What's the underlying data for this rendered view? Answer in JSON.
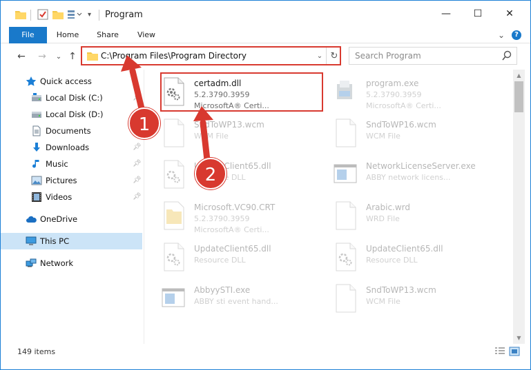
{
  "window": {
    "title": "Program",
    "minimize_glyph": "—",
    "maximize_glyph": "☐",
    "close_glyph": "✕"
  },
  "ribbon": {
    "tabs": [
      "File",
      "Home",
      "Share",
      "View"
    ],
    "collapse_glyph": "⌄",
    "help_glyph": "?"
  },
  "nav": {
    "back_glyph": "←",
    "forward_glyph": "→",
    "recent_glyph": "⌄",
    "up_glyph": "↑",
    "address": "C:\\Program Files\\Program Directory",
    "dropdown_glyph": "⌄",
    "refresh_glyph": "↻",
    "search_placeholder": "Search Program"
  },
  "sidebar": {
    "items": [
      {
        "label": "Quick access",
        "icon": "star-icon"
      },
      {
        "label": "Local Disk (C:)",
        "icon": "drive-icon",
        "pinned": true
      },
      {
        "label": "Local Disk (D:)",
        "icon": "drive-icon",
        "pinned": true
      },
      {
        "label": "Documents",
        "icon": "documents-icon",
        "pinned": true
      },
      {
        "label": "Downloads",
        "icon": "download-icon",
        "pinned": true
      },
      {
        "label": "Music",
        "icon": "music-icon",
        "pinned": true
      },
      {
        "label": "Pictures",
        "icon": "pictures-icon",
        "pinned": true
      },
      {
        "label": "Videos",
        "icon": "videos-icon",
        "pinned": true
      },
      {
        "label": "OneDrive",
        "icon": "cloud-icon"
      },
      {
        "label": "This PC",
        "icon": "pc-icon",
        "selected": true
      },
      {
        "label": "Network",
        "icon": "network-icon"
      }
    ]
  },
  "files": {
    "left": [
      {
        "name": "certadm.dll",
        "line2": "5.2.3790.3959",
        "line3": "MicrosoftA® Certi...",
        "icon": "dll-gear-icon"
      },
      {
        "name": "SndToWP13.wcm",
        "line2": "WCM File",
        "line3": "",
        "icon": "blank-file-icon"
      },
      {
        "name": "UpdateClient65.dll",
        "line2": "Resource DLL",
        "line3": "",
        "icon": "dll-gear-icon"
      },
      {
        "name": "Microsoft.VC90.CRT",
        "line2": "5.2.3790.3959",
        "line3": "MicrosoftA® Certi...",
        "icon": "folder-file-icon"
      },
      {
        "name": "UpdateClient65.dll",
        "line2": "Resource DLL",
        "line3": "",
        "icon": "dll-gear-icon"
      },
      {
        "name": "AbbyySTI.exe",
        "line2": "ABBY sti event hand...",
        "line3": "",
        "icon": "exe-window-icon"
      }
    ],
    "right": [
      {
        "name": "program.exe",
        "line2": "5.2.3790.3959",
        "line3": "MicrosoftA® Certi...",
        "icon": "installer-icon"
      },
      {
        "name": "SndToWP16.wcm",
        "line2": "WCM File",
        "line3": "",
        "icon": "blank-file-icon"
      },
      {
        "name": "NetworkLicenseServer.exe",
        "line2": "ABBY network licens...",
        "line3": "",
        "icon": "exe-window-icon"
      },
      {
        "name": "Arabic.wrd",
        "line2": "WRD File",
        "line3": "",
        "icon": "blank-file-icon"
      },
      {
        "name": "UpdateClient65.dll",
        "line2": "Resource DLL",
        "line3": "",
        "icon": "dll-gear-icon"
      },
      {
        "name": "SndToWP13.wcm",
        "line2": "WCM File",
        "line3": "",
        "icon": "blank-file-icon"
      }
    ]
  },
  "status": {
    "item_count": "149 items"
  },
  "annotations": {
    "step1": "1",
    "step2": "2",
    "color": "#d8392f"
  },
  "colors": {
    "accent": "#1979ca",
    "selection": "#cce4f7",
    "highlight": "#d8392f"
  }
}
